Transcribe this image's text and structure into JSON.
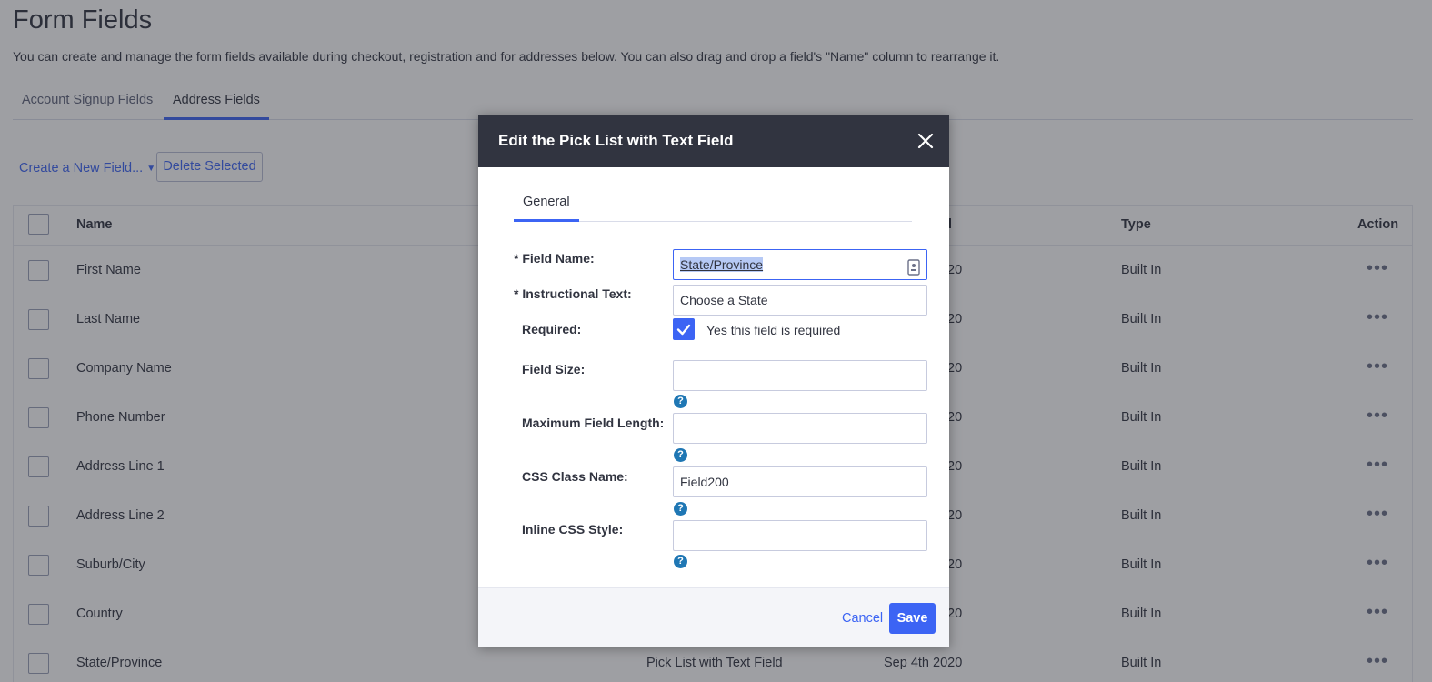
{
  "page": {
    "title": "Form Fields",
    "description": "You can create and manage the form fields available during checkout, registration and for addresses below. You can also drag and drop a field's \"Name\" column to rearrange it.",
    "tabs": [
      {
        "label": "Account Signup Fields",
        "active": false
      },
      {
        "label": "Address Fields",
        "active": true
      }
    ]
  },
  "toolbar": {
    "create_label": "Create a New Field...",
    "delete_label": "Delete Selected"
  },
  "table": {
    "headers": {
      "name": "Name",
      "created": "ed",
      "type": "Type",
      "action": "Action"
    },
    "rows": [
      {
        "name": "First Name",
        "created": "20",
        "built": "Built In"
      },
      {
        "name": "Last Name",
        "created": "20",
        "built": "Built In"
      },
      {
        "name": "Company Name",
        "created": "20",
        "built": "Built In"
      },
      {
        "name": "Phone Number",
        "created": "20",
        "built": "Built In"
      },
      {
        "name": "Address Line 1",
        "created": "20",
        "built": "Built In"
      },
      {
        "name": "Address Line 2",
        "created": "20",
        "built": "Built In"
      },
      {
        "name": "Suburb/City",
        "created": "20",
        "built": "Built In"
      },
      {
        "name": "Country",
        "created": "20",
        "built": "Built In"
      },
      {
        "name": "State/Province",
        "type": "Pick List with Text Field",
        "created": "Sep 4th 2020",
        "built": "Built In"
      }
    ],
    "action_glyph": "•••"
  },
  "modal": {
    "title": "Edit the Pick List with Text Field",
    "tab": "General",
    "field_name_label": "* Field Name:",
    "field_name_value": "State/Province",
    "instructional_label": "* Instructional Text:",
    "instructional_value": "Choose a State",
    "required_label": "Required:",
    "required_checked": true,
    "required_text": "Yes this field is required",
    "field_size_label": "Field Size:",
    "field_size_value": "",
    "max_length_label": "Maximum Field Length:",
    "max_length_value": "",
    "css_class_label": "CSS Class Name:",
    "css_class_value": "Field200",
    "inline_css_label": "Inline CSS Style:",
    "inline_css_value": "",
    "help_glyph": "?",
    "cancel_label": "Cancel",
    "save_label": "Save"
  },
  "colors": {
    "accent": "#3c64f4",
    "header_dark": "#313440",
    "help_blue": "#1f77b4"
  }
}
